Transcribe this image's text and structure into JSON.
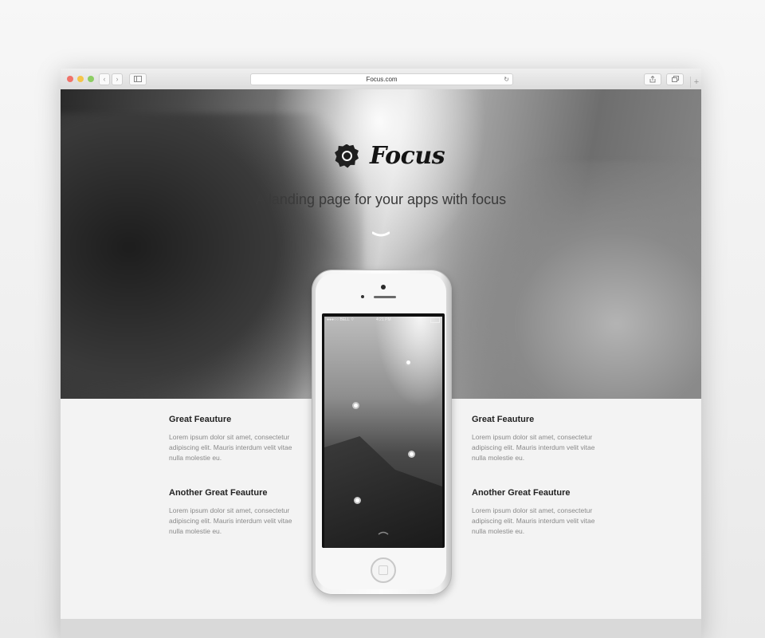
{
  "browser": {
    "url": "Focus.com",
    "back_glyph": "‹",
    "forward_glyph": "›",
    "reload_glyph": "↻",
    "newtab_glyph": "+"
  },
  "hero": {
    "brand": "Focus",
    "tagline": "A landing page for your apps with focus"
  },
  "features": [
    {
      "title": "Great Feauture",
      "text": "Lorem ipsum dolor sit amet, consectetur adipiscing elit. Mauris interdum velit vitae nulla molestie eu."
    },
    {
      "title": "Another Great Feauture",
      "text": "Lorem ipsum dolor sit amet, consectetur adipiscing elit. Mauris interdum velit vitae nulla molestie eu."
    },
    {
      "title": "Great Feauture",
      "text": "Lorem ipsum dolor sit amet, consectetur adipiscing elit. Mauris interdum velit vitae nulla molestie eu."
    },
    {
      "title": "Another Great Feauture",
      "text": "Lorem ipsum dolor sit amet, consectetur adipiscing elit. Mauris interdum velit vitae nulla molestie eu."
    }
  ],
  "phone": {
    "carrier": "●●●○○ BELL ⌔",
    "time": "4:21 PM"
  },
  "colors": {
    "traffic_red": "#f0736a",
    "traffic_yellow": "#f5c54a",
    "traffic_green": "#8ccd63"
  }
}
